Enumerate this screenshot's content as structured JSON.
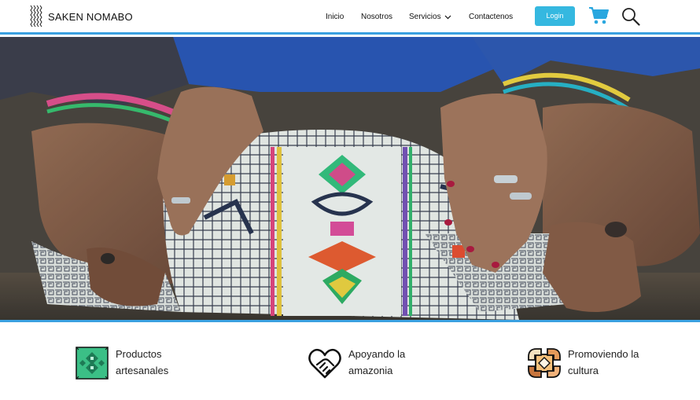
{
  "brand": {
    "name": "SAKEN NOMABO",
    "logo_icon": "woven-pattern-icon"
  },
  "nav": {
    "items": [
      {
        "label": "Inicio"
      },
      {
        "label": "Nosotros"
      },
      {
        "label": "Servicios",
        "has_dropdown": true
      },
      {
        "label": "Contactenos"
      }
    ]
  },
  "actions": {
    "login_label": "Login",
    "cart_icon": "shopping-cart-icon",
    "search_icon": "search-icon"
  },
  "hero": {
    "image": "hands-and-embroidered-textile-photo"
  },
  "features": [
    {
      "title": "Productos artesanales",
      "line1": "Productos",
      "line2": "artesanales",
      "icon": "textile-pattern-icon"
    },
    {
      "title": "Apoyando la amazonia",
      "line1": "Apoyando la",
      "line2": "amazonia",
      "icon": "heart-handshake-icon"
    },
    {
      "title": "Promoviendo la cultura",
      "line1": "Promoviendo la",
      "line2": "cultura",
      "icon": "hands-circle-icon"
    }
  ],
  "colors": {
    "accent": "#3aa0e0",
    "login_button": "#35b8e0",
    "text": "#111111"
  }
}
